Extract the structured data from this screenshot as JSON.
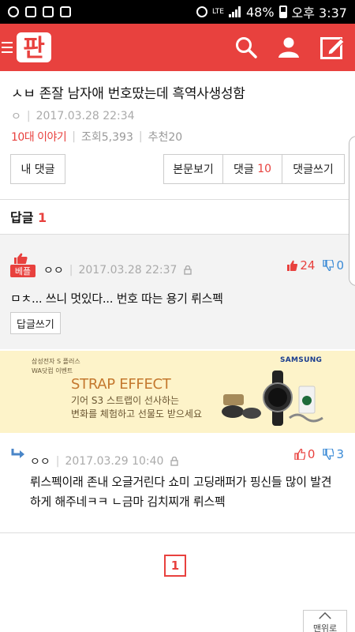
{
  "status_bar": {
    "network": "LTE",
    "battery": "48%",
    "time": "오후 3:37",
    "icons": [
      "recycle-icon",
      "file-icon",
      "pann-icon",
      "image-icon",
      "alarm-icon",
      "lte-icon",
      "signal-icon",
      "battery-icon"
    ]
  },
  "header": {
    "logo_text": "판",
    "icons": [
      "menu-icon",
      "search-icon",
      "user-icon",
      "write-icon"
    ]
  },
  "article": {
    "title": "ㅅㅂ 존잘 남자애 번호땄는데 흑역사생성함",
    "author": "ㅇ",
    "date": "2017.03.28 22:34",
    "category": "10대 이야기",
    "views": "조회5,393",
    "recommend": "추천20"
  },
  "toolbar": {
    "my_comments": "내 댓글",
    "view_post": "본문보기",
    "comments_label": "댓글",
    "comments_count": "10",
    "write_comment": "댓글쓰기"
  },
  "replies": {
    "label": "답글",
    "count": "1"
  },
  "best_comment": {
    "badge": "베플",
    "author": "ㅇㅇ",
    "date": "2017.03.28 22:37",
    "up": "24",
    "down": "0",
    "text": "ㅁㅊ... 쓰니 멋있다... 번호 따는 용기 뤼스펙",
    "reply_button": "답글쓰기"
  },
  "ad": {
    "brand_line": "삼성전자 S 플러스",
    "event_line": "WA닷컴 이벤트",
    "samsung": "SAMSUNG",
    "headline": "STRAP EFFECT",
    "body_line1": "기어 S3 스트랩이 선사하는",
    "body_line2": "변화를 체험하고 선물도 받으세요"
  },
  "reply_comment": {
    "author": "ㅇㅇ",
    "date": "2017.03.29 10:40",
    "up": "0",
    "down": "3",
    "text": "뤼스펙이래 존내 오글거린다 쇼미 고딩래퍼가 핑신들 많이 발견하게 해주네ㅋㅋ ㄴ금마 김치찌개 뤼스펙"
  },
  "pagination": {
    "current": "1"
  },
  "scroll_top": {
    "label": "맨위로"
  },
  "colors": {
    "brand_red": "#e8413e",
    "down_blue": "#3a8ad6",
    "ad_bg": "#fdf3c9"
  }
}
